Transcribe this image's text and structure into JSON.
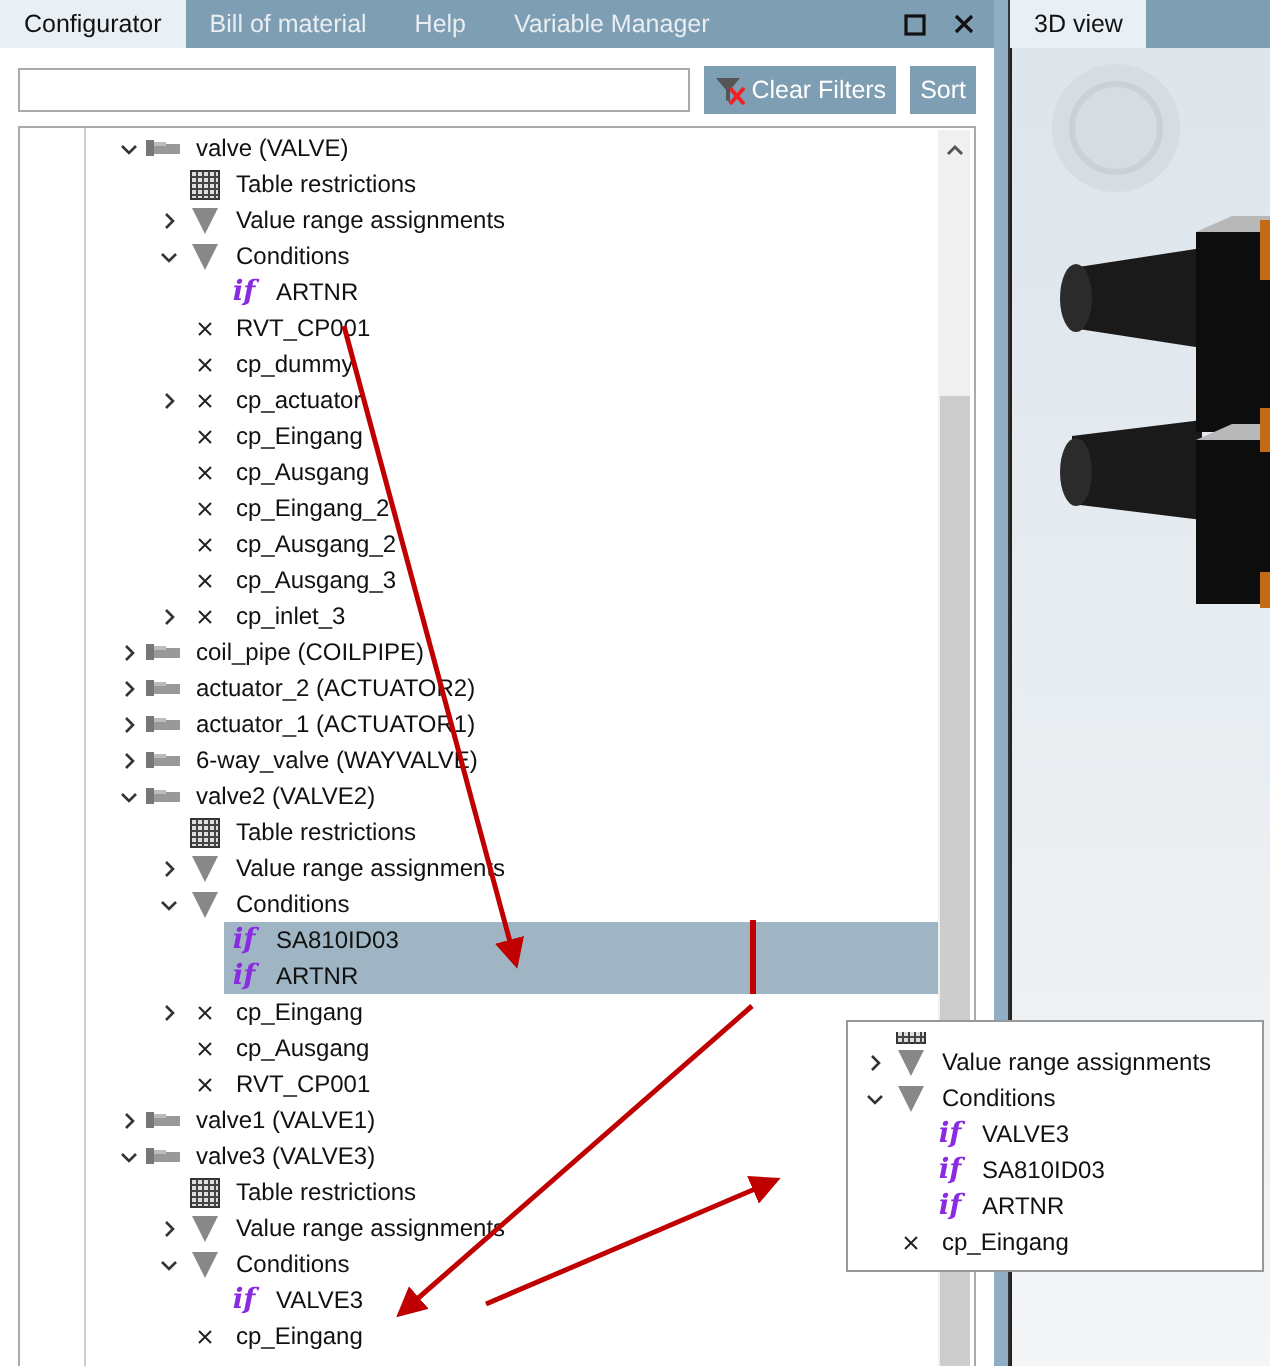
{
  "left_panel": {
    "tabs": [
      {
        "label": "Configurator",
        "selected": true
      },
      {
        "label": "Bill of material",
        "selected": false
      },
      {
        "label": "Help",
        "selected": false
      },
      {
        "label": "Variable Manager",
        "selected": false
      }
    ],
    "buttons": [
      {
        "label": "Clear Filters",
        "kind": "filter"
      },
      {
        "label": "Sort",
        "kind": "plain"
      }
    ],
    "tree": [
      {
        "kind": "component",
        "label": "valve (VALVE)",
        "expanded": true,
        "selected": false,
        "children": [
          {
            "kind": "table",
            "label": "Table restrictions",
            "selected": false
          },
          {
            "kind": "filter",
            "label": "Value range assignments",
            "expanded": false,
            "selected": false
          },
          {
            "kind": "filter",
            "label": "Conditions",
            "expanded": true,
            "selected": false,
            "children": [
              {
                "kind": "condition",
                "icon": "if",
                "label": "ARTNR",
                "selected": false
              }
            ]
          },
          {
            "kind": "parameter",
            "label": "RVT_CP001",
            "selected": false
          },
          {
            "kind": "parameter",
            "label": "cp_dummy",
            "selected": false
          },
          {
            "kind": "parameter",
            "label": "cp_actuator",
            "expanded": false,
            "selected": false
          },
          {
            "kind": "parameter",
            "label": "cp_Eingang",
            "selected": false
          },
          {
            "kind": "parameter",
            "label": "cp_Ausgang",
            "selected": false
          },
          {
            "kind": "parameter",
            "label": "cp_Eingang_2",
            "selected": false
          },
          {
            "kind": "parameter",
            "label": "cp_Ausgang_2",
            "selected": false
          },
          {
            "kind": "parameter",
            "label": "cp_Ausgang_3",
            "selected": false
          },
          {
            "kind": "parameter",
            "label": "cp_inlet_3",
            "expanded": false,
            "selected": false
          }
        ]
      },
      {
        "kind": "component",
        "label": "coil_pipe (COILPIPE)",
        "expanded": false,
        "selected": false
      },
      {
        "kind": "component",
        "label": "actuator_2 (ACTUATOR2)",
        "expanded": false,
        "selected": false
      },
      {
        "kind": "component",
        "label": "actuator_1 (ACTUATOR1)",
        "expanded": false,
        "selected": false
      },
      {
        "kind": "component",
        "label": "6-way_valve (WAYVALVE)",
        "expanded": false,
        "selected": false
      },
      {
        "kind": "component",
        "label": "valve2 (VALVE2)",
        "expanded": true,
        "selected": false,
        "children": [
          {
            "kind": "table",
            "label": "Table restrictions",
            "selected": false
          },
          {
            "kind": "filter",
            "label": "Value range assignments",
            "expanded": false,
            "selected": false
          },
          {
            "kind": "filter",
            "label": "Conditions",
            "expanded": true,
            "selected": false,
            "children": [
              {
                "kind": "condition",
                "icon": "if",
                "label": "SA810ID03",
                "selected": true
              },
              {
                "kind": "condition",
                "icon": "if",
                "label": "ARTNR",
                "selected": true
              }
            ]
          },
          {
            "kind": "parameter",
            "label": "cp_Eingang",
            "expanded": false,
            "selected": false
          },
          {
            "kind": "parameter",
            "label": "cp_Ausgang",
            "selected": false
          },
          {
            "kind": "parameter",
            "label": "RVT_CP001",
            "selected": false
          }
        ]
      },
      {
        "kind": "component",
        "label": "valve1 (VALVE1)",
        "expanded": false,
        "selected": false
      },
      {
        "kind": "component",
        "label": "valve3 (VALVE3)",
        "expanded": true,
        "selected": false,
        "children": [
          {
            "kind": "table",
            "label": "Table restrictions",
            "selected": false
          },
          {
            "kind": "filter",
            "label": "Value range assignments",
            "expanded": false,
            "selected": false
          },
          {
            "kind": "filter",
            "label": "Conditions",
            "expanded": true,
            "selected": false,
            "children": [
              {
                "kind": "condition",
                "icon": "if",
                "label": "VALVE3",
                "selected": false
              }
            ]
          },
          {
            "kind": "parameter",
            "label": "cp_Eingang",
            "selected": false
          }
        ]
      }
    ]
  },
  "right_panel": {
    "tabs": [
      {
        "label": "3D view",
        "selected": true
      }
    ]
  },
  "inset": {
    "nodes": [
      {
        "kind": "filter",
        "label": "Value range assignments",
        "expanded": false,
        "selected": false
      },
      {
        "kind": "filter",
        "label": "Conditions",
        "expanded": true,
        "selected": false,
        "children": [
          {
            "kind": "condition",
            "icon": "if",
            "label": "VALVE3",
            "selected": false
          },
          {
            "kind": "condition",
            "icon": "if",
            "label": "SA810ID03",
            "selected": false
          },
          {
            "kind": "condition",
            "icon": "if",
            "label": "ARTNR",
            "selected": false
          }
        ]
      },
      {
        "kind": "parameter",
        "label": "cp_Eingang",
        "selected": false
      }
    ]
  }
}
